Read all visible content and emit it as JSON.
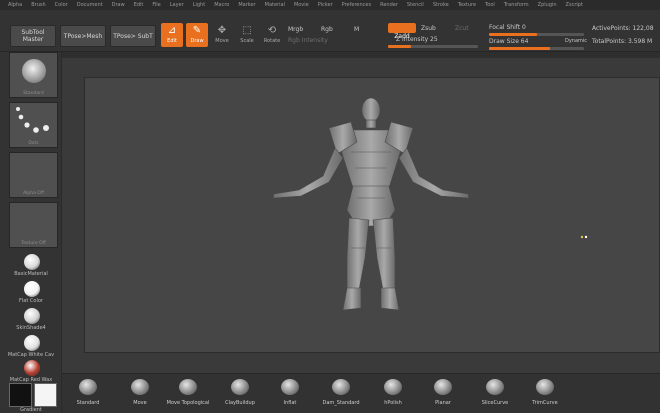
{
  "menu": [
    "Alpha",
    "Brush",
    "Color",
    "Document",
    "Draw",
    "Edit",
    "File",
    "Layer",
    "Light",
    "Macro",
    "Marker",
    "Material",
    "Movie",
    "Picker",
    "Preferences",
    "Render",
    "Stencil",
    "Stroke",
    "Texture",
    "Tool",
    "Transform",
    "Zplugin",
    "Zscript"
  ],
  "topbar": {
    "subtool_master": "SubTool Master",
    "tpose_mesh": "TPose>Mesh",
    "tpose_subt": "TPose> SubT",
    "tools": [
      {
        "label": "Edit",
        "state": "active",
        "icon": "edit-icon",
        "glyph": "⊿"
      },
      {
        "label": "Draw",
        "state": "active",
        "icon": "draw-icon",
        "glyph": "✎"
      },
      {
        "label": "Move",
        "state": "inactive",
        "icon": "move-icon",
        "glyph": "✥"
      },
      {
        "label": "Scale",
        "state": "inactive",
        "icon": "scale-icon",
        "glyph": "⬚"
      },
      {
        "label": "Rotate",
        "state": "inactive",
        "icon": "rotate-icon",
        "glyph": "⟲"
      }
    ],
    "mrgb": "Mrgb",
    "rgb": "Rgb",
    "m": "M",
    "zadd": "Zadd",
    "zsub": "Zsub",
    "zcut": "Zcut",
    "rgb_intensity": "Rgb Intensity",
    "z_intensity": "Z Intensity 25",
    "z_intensity_value": 0.25,
    "focal_shift": "Focal Shift 0",
    "focal_shift_value": 0.5,
    "draw_size": "Draw Size 64",
    "draw_size_value": 0.64,
    "dynamic": "Dynamic",
    "active_points": "ActivePoints: 122,08",
    "total_points": "TotalPoints: 3.598 M",
    "accent": "#e8701e"
  },
  "left_shelf": {
    "brush_thumb": "Standard",
    "stroke_thumb": "Dots",
    "alpha_thumb": "Alpha Off",
    "texture_thumb": "Texture Off",
    "materials": [
      {
        "label": "BasicMaterial",
        "color": "#d8d8d8"
      },
      {
        "label": "Flat Color",
        "color": "#f2f2f2"
      },
      {
        "label": "SkinShade4",
        "color": "#cfcfcf"
      },
      {
        "label": "MatCap White Cav",
        "color": "#e0e0e0"
      },
      {
        "label": "MatCap Red Wax",
        "color": "#b23a2a"
      }
    ],
    "colors": [
      "#111111",
      "#f5f5f5"
    ],
    "color_label": "Gradient"
  },
  "brushes": [
    "Standard",
    "Move",
    "Move Topological",
    "ClayBuildup",
    "Inflat",
    "Dam_Standard",
    "hPolish",
    "Planar",
    "SliceCurve",
    "TrimCurve"
  ]
}
